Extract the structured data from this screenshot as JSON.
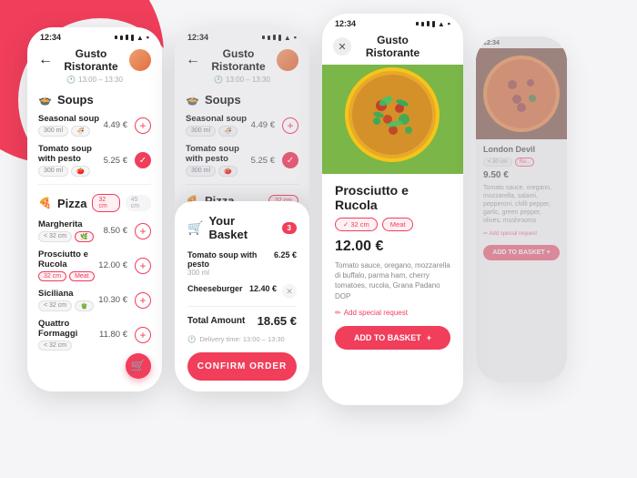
{
  "background": {
    "blob_color": "#f03e5b"
  },
  "app": {
    "title": "Gusto Ristorante",
    "time": "12:34",
    "hours": "13:00 – 13:30",
    "back_label": "←",
    "close_label": "✕"
  },
  "sections": {
    "soups": {
      "label": "Soups",
      "icon": "🍲"
    },
    "pizza": {
      "label": "Pizza",
      "icon": "🍕"
    }
  },
  "menu": {
    "soups": [
      {
        "name": "Seasonal soup",
        "price": "4.49 €",
        "size": "300 ml",
        "added": false
      },
      {
        "name": "Tomato soup with pesto",
        "price": "5.25 €",
        "size": "300 ml",
        "added": true
      }
    ],
    "pizzas": [
      {
        "name": "Margherita",
        "price": "8.50 €",
        "sizes": [
          "˂ 32 cm"
        ],
        "added": false
      },
      {
        "name": "Prosciutto e Rucola",
        "price": "12.00 €",
        "sizes": [
          "32 cm",
          "Meat"
        ],
        "added": false
      },
      {
        "name": "Siciliana",
        "price": "10.30 €",
        "sizes": [
          "˂ 32 cm"
        ],
        "added": false
      },
      {
        "name": "Quattro Formaggi",
        "price": "11.80 €",
        "sizes": [
          "˂ 32 cm"
        ],
        "added": false
      }
    ]
  },
  "basket": {
    "title": "Your Basket",
    "count": "3",
    "items": [
      {
        "name": "Tomato soup with pesto",
        "sub": "300 ml",
        "price": "6.25 €"
      },
      {
        "name": "Cheeseburger",
        "sub": "",
        "price": "12.40 €"
      }
    ],
    "total_label": "Total Amount",
    "total_value": "18.65 €",
    "delivery_label": "Delivery time: 13:00 – 13:30",
    "confirm_label": "CONFIRM ORDER"
  },
  "product_detail": {
    "name": "Prosciutto e Rucola",
    "sizes": [
      "32 cm",
      "Meat"
    ],
    "price": "12.00 €",
    "description": "Tomato sauce, oregano, mozzarella di buffalo, parma ham, cherry tomatoes, rucola, Grana Padano DOP",
    "special_request": "Add special request",
    "add_to_basket": "ADD TO BASKET"
  },
  "product_detail_2": {
    "name": "London Devil",
    "price": "9.50 €",
    "sizes": [
      "˂ 30 cm",
      "Re.."
    ],
    "description": "Tomato sauce, oregano, mozzarella, salami, pepperoni, chilli pepper, garlic, green pepper, olives, mushrooms",
    "special_request": "Add special request",
    "add_to_basket": "ADD TO BASKET"
  }
}
